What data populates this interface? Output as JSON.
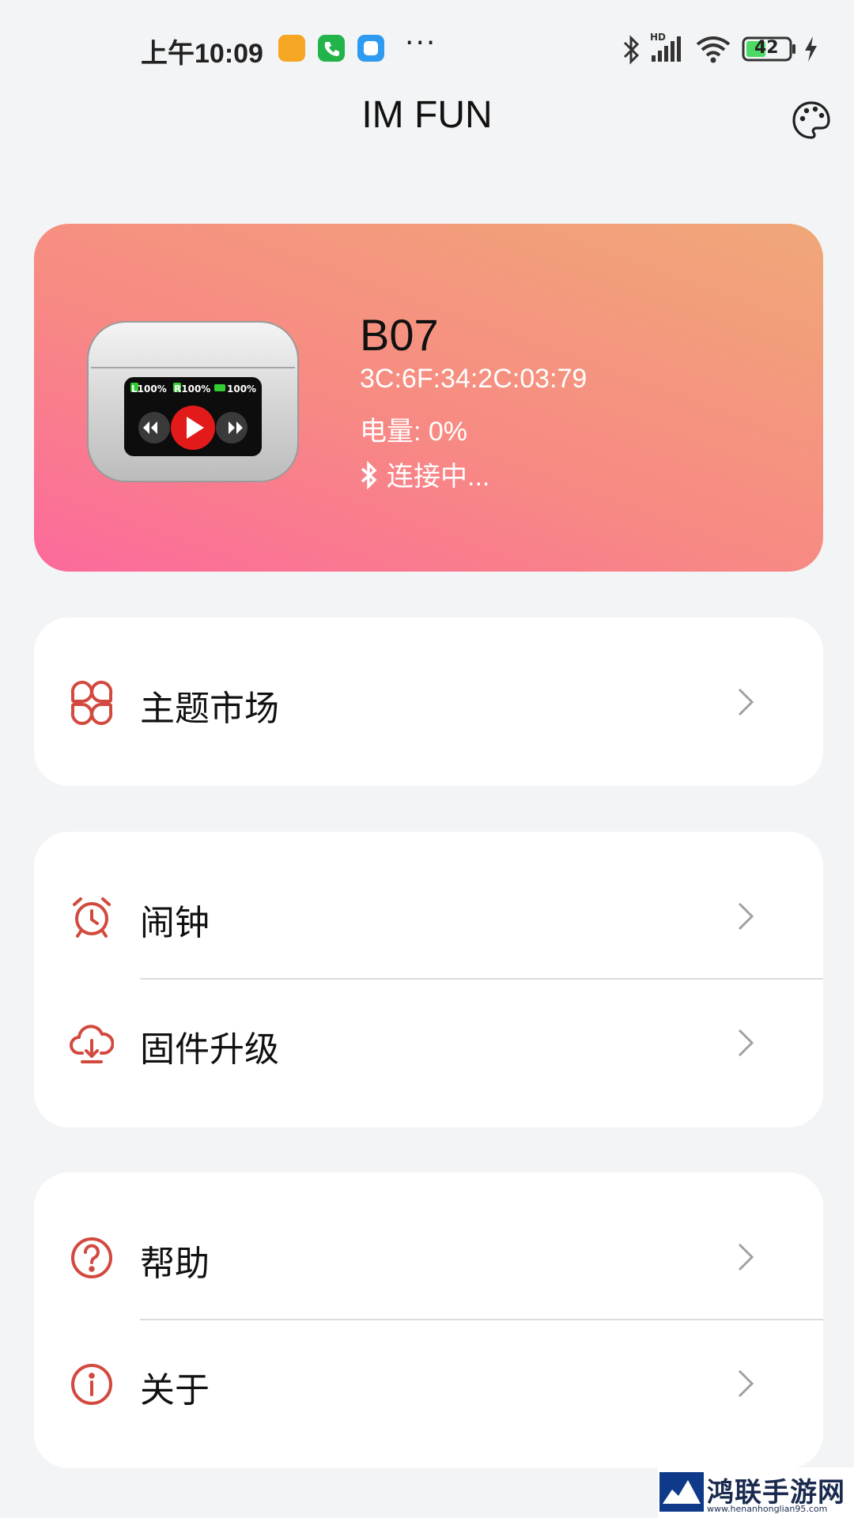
{
  "status_bar": {
    "time": "上午10:09",
    "notification_icons": [
      "note-app-icon",
      "phone-app-icon",
      "message-app-icon"
    ],
    "more_indicator": "···",
    "network_label": "HD",
    "battery_level": "42",
    "charging": true
  },
  "header": {
    "title": "IM FUN",
    "theme_icon": "palette-icon"
  },
  "device": {
    "name": "B07",
    "mac": "3C:6F:34:2C:03:79",
    "battery": "电量: 0%",
    "status": "连接中...",
    "image_icon": "earbuds-case-icon",
    "case_screen": {
      "left": "L100%",
      "right": "R100%",
      "case": "100%"
    }
  },
  "menu": {
    "theme_market": {
      "label": "主题市场",
      "icon": "theme-grid-icon"
    },
    "alarm": {
      "label": "闹钟",
      "icon": "alarm-clock-icon"
    },
    "firmware": {
      "label": "固件升级",
      "icon": "cloud-download-icon"
    },
    "help": {
      "label": "帮助",
      "icon": "help-circle-icon"
    },
    "about": {
      "label": "关于",
      "icon": "info-circle-icon"
    }
  },
  "colors": {
    "accent_icon": "#d24a3f",
    "card_gradient_start": "#fc6a9c",
    "card_gradient_end": "#f0a878",
    "background": "#f3f4f6"
  },
  "watermark": {
    "text": "鸿联手游网",
    "url": "www.henanhonglian95.com"
  }
}
